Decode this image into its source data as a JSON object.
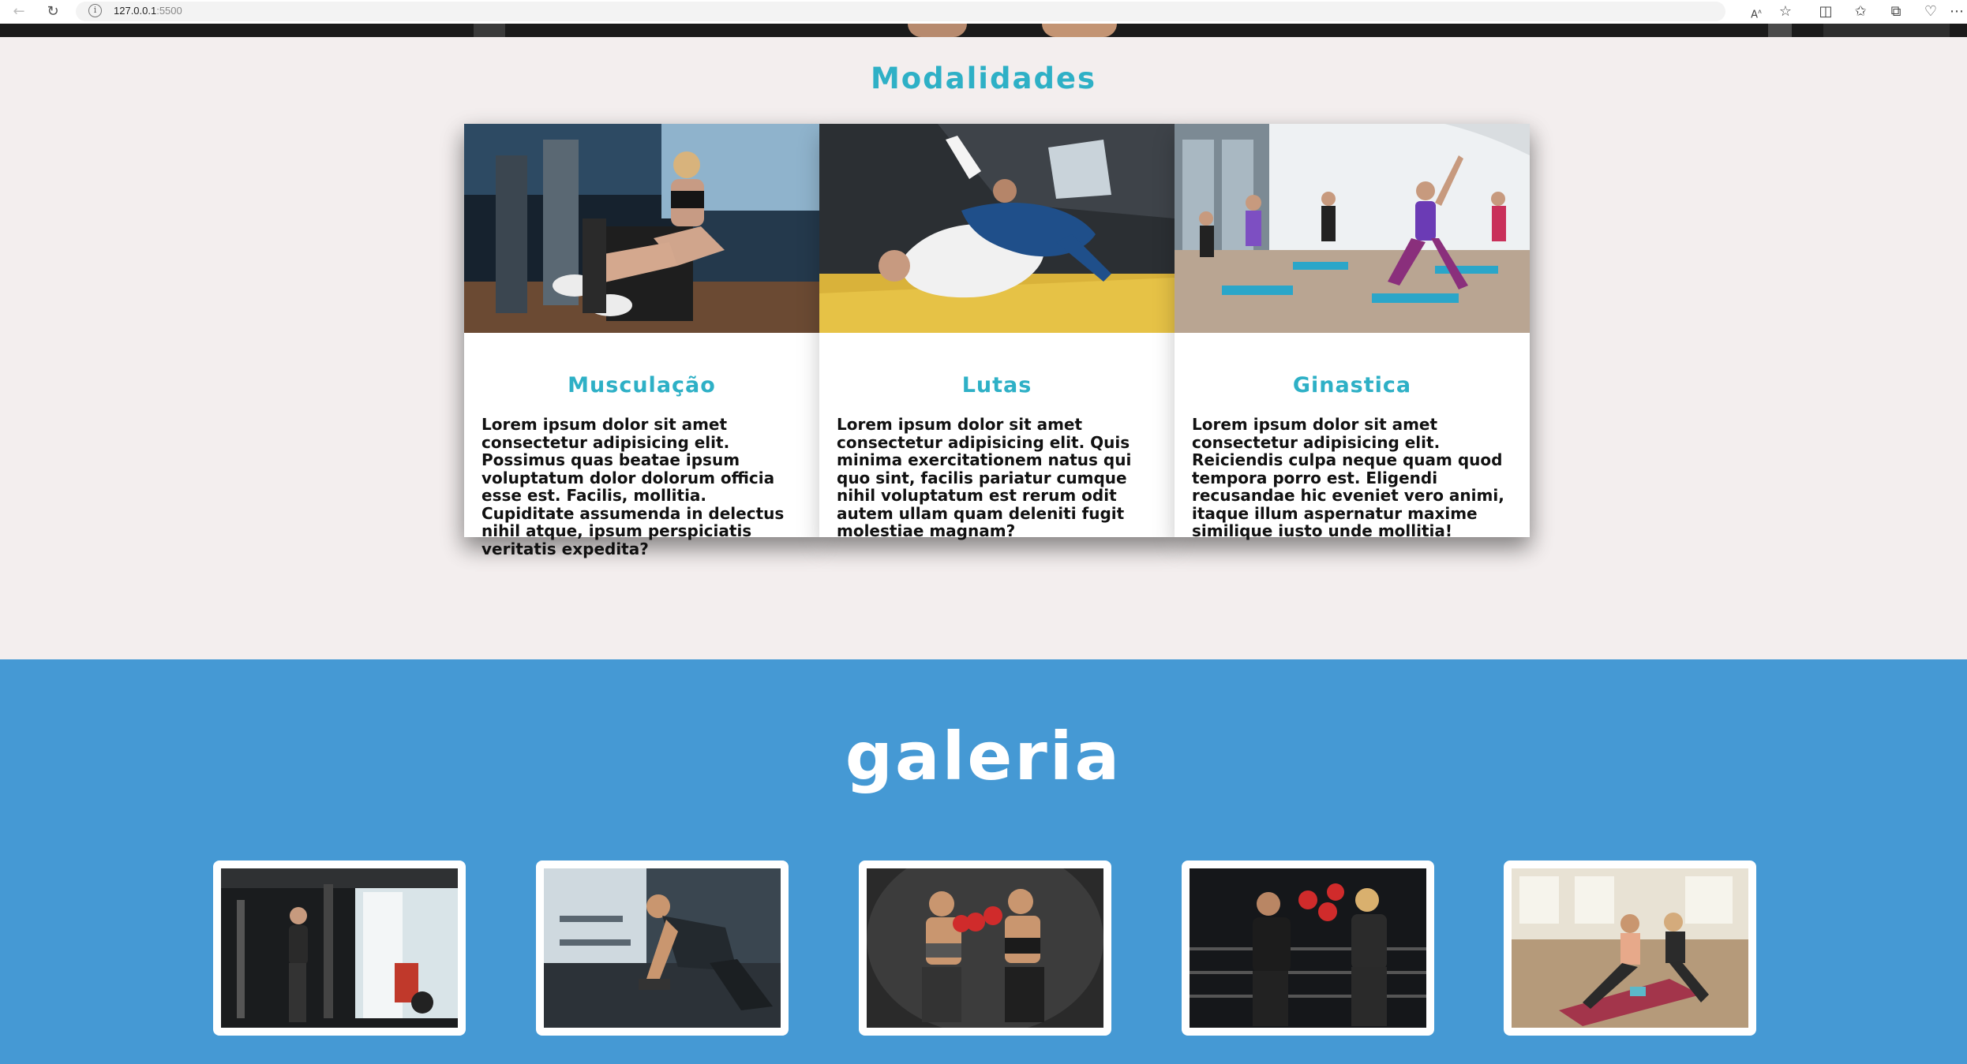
{
  "browser": {
    "url_host": "127.0.0.1",
    "url_port": ":5500",
    "tools": [
      "read-aloud-icon",
      "favorite-star-icon",
      "split-screen-icon",
      "favorites-icon",
      "collections-icon",
      "browser-essentials-icon",
      "more-icon"
    ]
  },
  "modalidades": {
    "title": "Modalidades",
    "cards": [
      {
        "title": "Musculação",
        "text": "Lorem ipsum dolor sit amet consectetur adipisicing elit. Possimus quas beatae ipsum voluptatum dolor dolorum officia esse est. Facilis, mollitia. Cupiditate assumenda in delectus nihil atque, ipsum perspiciatis veritatis expedita?"
      },
      {
        "title": "Lutas",
        "text": "Lorem ipsum dolor sit amet consectetur adipisicing elit. Quis minima exercitationem natus qui quo sint, facilis pariatur cumque nihil voluptatum est rerum odit autem ullam quam deleniti fugit molestiae magnam?"
      },
      {
        "title": "Ginastica",
        "text": "Lorem ipsum dolor sit amet consectetur adipisicing elit. Reiciendis culpa neque quam quod tempora porro est. Eligendi recusandae hic eveniet vero animi, itaque illum aspernatur maxime similique iusto unde mollitia!"
      }
    ]
  },
  "galeria": {
    "title": "galeria"
  },
  "colors": {
    "accent": "#2eb0c6",
    "gallery_bg": "#4599d4",
    "page_bg": "#f3eeee"
  }
}
